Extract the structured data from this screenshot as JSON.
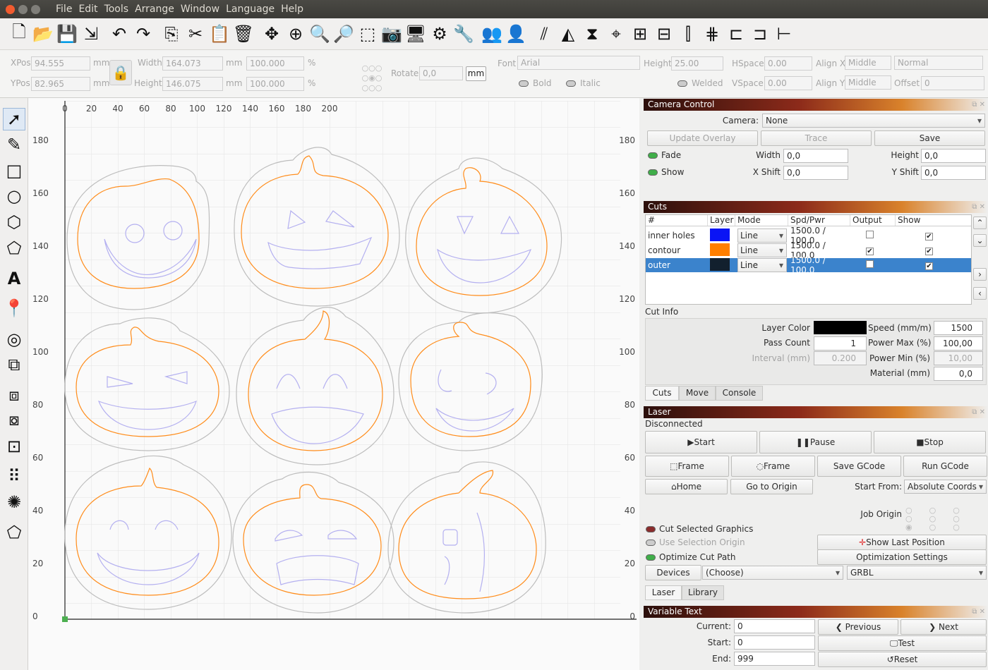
{
  "titlebar": {
    "menus": [
      "File",
      "Edit",
      "Tools",
      "Arrange",
      "Window",
      "Language",
      "Help"
    ]
  },
  "props": {
    "xpos_label": "XPos",
    "xpos": "94.555",
    "ypos_label": "YPos",
    "ypos": "82.965",
    "mm": "mm",
    "width_label": "Width",
    "width": "164.073",
    "height_label": "Height",
    "height": "146.075",
    "scale_x": "100.000",
    "scale_y": "100.000",
    "pct": "%",
    "rotate_label": "Rotate",
    "rotate": "0,0",
    "rotate_unit": "mm",
    "font_label": "Font",
    "font": "Arial",
    "fheight_label": "Height",
    "fheight": "25.00",
    "hspace_label": "HSpace",
    "hspace": "0.00",
    "vspace_label": "VSpace",
    "vspace": "0.00",
    "alignx_label": "Align X",
    "alignx": "Middle",
    "aligny_label": "Align Y",
    "aligny": "Middle",
    "normal": "Normal",
    "offset_label": "Offset",
    "offset": "0",
    "bold": "Bold",
    "italic": "Italic",
    "welded": "Welded"
  },
  "ruler": {
    "x_ticks": [
      "0",
      "20",
      "40",
      "60",
      "80",
      "100",
      "120",
      "140",
      "160",
      "180",
      "200"
    ],
    "y_ticks": [
      "180",
      "160",
      "140",
      "120",
      "100",
      "80",
      "60",
      "40",
      "20",
      "0"
    ]
  },
  "camera": {
    "title": "Camera Control",
    "camera_label": "Camera:",
    "camera": "None",
    "update_overlay": "Update Overlay",
    "trace": "Trace",
    "save": "Save",
    "fade": "Fade",
    "show": "Show",
    "width_label": "Width",
    "width": "0,0",
    "height_label": "Height",
    "height": "0,0",
    "xshift_label": "X Shift",
    "xshift": "0,0",
    "yshift_label": "Y Shift",
    "yshift": "0,0"
  },
  "cuts": {
    "title": "Cuts",
    "headers": [
      "#",
      "Layer",
      "Mode",
      "Spd/Pwr",
      "Output",
      "Show"
    ],
    "rows": [
      {
        "name": "inner holes",
        "color": "#0a14f5",
        "mode": "Line",
        "spd": "1500.0 / 100.0",
        "output": false,
        "show": true
      },
      {
        "name": "contour",
        "color": "#ff7f00",
        "mode": "Line",
        "spd": "1500.0 / 100.0",
        "output": true,
        "show": true
      },
      {
        "name": "outer",
        "color": "#12202e",
        "mode": "Line",
        "spd": "1500.0 / 100.0",
        "output": false,
        "show": true
      }
    ],
    "cut_info": "Cut Info",
    "layer_color": "Layer Color",
    "speed_label": "Speed (mm/m)",
    "speed": "1500",
    "pass_count": "Pass Count",
    "pass": "1",
    "power_max_label": "Power Max (%)",
    "power_max": "100,00",
    "interval_label": "Interval (mm)",
    "interval": "0.200",
    "power_min_label": "Power Min (%)",
    "power_min": "10,00",
    "material_label": "Material (mm)",
    "material": "0,0",
    "tabs": [
      "Cuts",
      "Move",
      "Console"
    ]
  },
  "laser": {
    "title": "Laser",
    "status": "Disconnected",
    "start": "Start",
    "pause": "Pause",
    "stop": "Stop",
    "frame1": "Frame",
    "frame2": "Frame",
    "save_gcode": "Save GCode",
    "run_gcode": "Run GCode",
    "home": "Home",
    "go_origin": "Go to Origin",
    "start_from_label": "Start From:",
    "start_from": "Absolute Coords",
    "job_origin": "Job Origin",
    "cut_selected": "Cut Selected Graphics",
    "use_selection": "Use Selection Origin",
    "show_last": "Show Last Position",
    "optimize": "Optimize Cut Path",
    "opt_settings": "Optimization Settings",
    "devices": "Devices",
    "choose": "(Choose)",
    "grbl": "GRBL",
    "tabs": [
      "Laser",
      "Library"
    ]
  },
  "vartext": {
    "title": "Variable Text",
    "current_label": "Current:",
    "current": "0",
    "start_label": "Start:",
    "start": "0",
    "end_label": "End:",
    "end": "999",
    "previous": "Previous",
    "next": "Next",
    "test": "Test",
    "reset": "Reset"
  }
}
